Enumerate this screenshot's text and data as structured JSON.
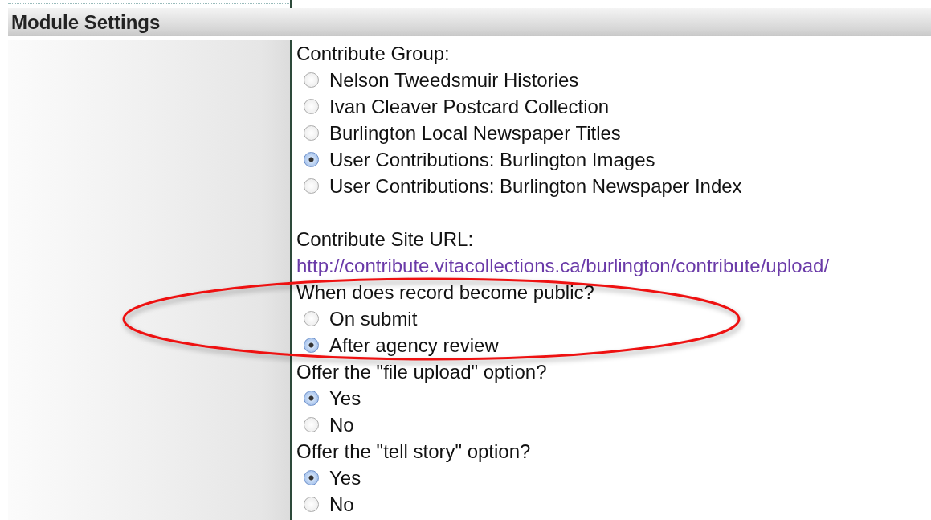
{
  "panel": {
    "title": "Module Settings"
  },
  "sections": [
    {
      "kind": "radio",
      "label": "Contribute Group:",
      "options": [
        {
          "label": "Nelson Tweedsmuir Histories",
          "selected": false
        },
        {
          "label": "Ivan Cleaver Postcard Collection",
          "selected": false
        },
        {
          "label": "Burlington Local Newspaper Titles",
          "selected": false
        },
        {
          "label": "User Contributions: Burlington Images",
          "selected": true
        },
        {
          "label": "User Contributions: Burlington Newspaper Index",
          "selected": false
        }
      ]
    },
    {
      "kind": "link",
      "label": "Contribute Site URL:",
      "url": "http://contribute.vitacollections.ca/burlington/contribute/upload/"
    },
    {
      "kind": "radio",
      "label": "When does record become public?",
      "options": [
        {
          "label": "On submit",
          "selected": false
        },
        {
          "label": "After agency review",
          "selected": true
        }
      ]
    },
    {
      "kind": "radio",
      "label": "Offer the \"file upload\" option?",
      "options": [
        {
          "label": "Yes",
          "selected": true
        },
        {
          "label": "No",
          "selected": false
        }
      ]
    },
    {
      "kind": "radio",
      "label": "Offer the \"tell story\" option?",
      "options": [
        {
          "label": "Yes",
          "selected": true
        },
        {
          "label": "No",
          "selected": false
        }
      ]
    }
  ],
  "highlight": {
    "kind": "ellipse"
  }
}
